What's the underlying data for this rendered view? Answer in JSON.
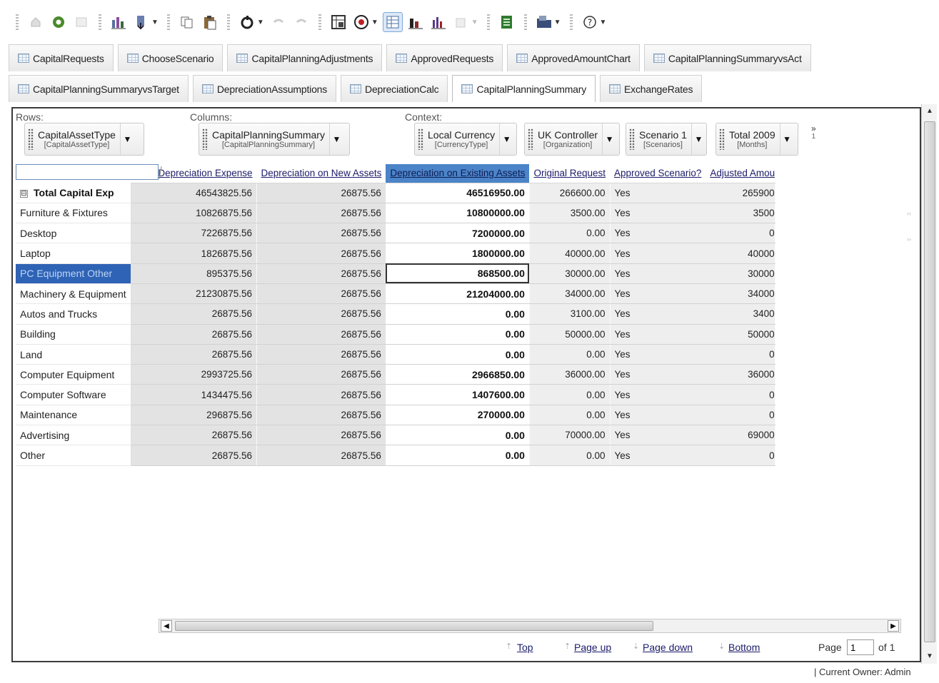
{
  "toolbar": {
    "icons": [
      "home-icon",
      "refresh-icon",
      "blank-icon",
      "chart-edit-icon",
      "export-icon",
      "copy-icon",
      "paste-icon",
      "calculate-icon",
      "undo-icon",
      "redo-icon",
      "grid-view-icon",
      "record-icon",
      "table-view-icon",
      "bar-chart-icon",
      "column-chart-icon",
      "pie-chart-icon",
      "spreadsheet-icon",
      "folder-icon",
      "help-icon"
    ],
    "active_icon": "table-view-icon"
  },
  "tabs_row1": [
    {
      "label": "CapitalRequests"
    },
    {
      "label": "ChooseScenario"
    },
    {
      "label": "CapitalPlanningAdjustments"
    },
    {
      "label": "ApprovedRequests"
    },
    {
      "label": "ApprovedAmountChart"
    },
    {
      "label": "CapitalPlanningSummaryvsAct"
    }
  ],
  "tabs_row2": [
    {
      "label": "CapitalPlanningSummaryvsTarget"
    },
    {
      "label": "DepreciationAssumptions"
    },
    {
      "label": "DepreciationCalc"
    },
    {
      "label": "CapitalPlanningSummary",
      "active": true
    },
    {
      "label": "ExchangeRates"
    }
  ],
  "axes": {
    "rows_label": "Rows:",
    "columns_label": "Columns:",
    "context_label": "Context:",
    "rows_dim": {
      "name": "CapitalAssetType",
      "sub": "[CapitalAssetType]"
    },
    "columns_dim": {
      "name": "CapitalPlanningSummary",
      "sub": "[CapitalPlanningSummary]"
    },
    "context_dims": [
      {
        "name": "Local Currency",
        "sub": "[CurrencyType]"
      },
      {
        "name": "UK Controller",
        "sub": "[Organization]"
      },
      {
        "name": "Scenario 1",
        "sub": "[Scenarios]"
      },
      {
        "name": "Total 2009",
        "sub": "[Months]"
      }
    ],
    "more_label": "»",
    "more_count": "1"
  },
  "grid": {
    "columns": [
      "Total Depreciation Expense",
      "Depreciation on New Assets",
      "Depreciation on Existing Assets",
      "Original Request",
      "Approved Scenario?",
      "Adjusted Amou"
    ],
    "selected_column": 2,
    "rows": [
      {
        "label": "Total Capital Exp",
        "total": true,
        "expander": "⊟",
        "values": [
          "46543825.56",
          "26875.56",
          "46516950.00",
          "266600.00",
          "Yes",
          "265900"
        ]
      },
      {
        "label": "Furniture & Fixtures",
        "values": [
          "10826875.56",
          "26875.56",
          "10800000.00",
          "3500.00",
          "Yes",
          "3500"
        ]
      },
      {
        "label": "Desktop",
        "values": [
          "7226875.56",
          "26875.56",
          "7200000.00",
          "0.00",
          "Yes",
          "0"
        ]
      },
      {
        "label": "Laptop",
        "values": [
          "1826875.56",
          "26875.56",
          "1800000.00",
          "40000.00",
          "Yes",
          "40000"
        ]
      },
      {
        "label": "PC Equipment Other",
        "selected": true,
        "values": [
          "895375.56",
          "26875.56",
          "868500.00",
          "30000.00",
          "Yes",
          "30000"
        ]
      },
      {
        "label": "Machinery & Equipment",
        "values": [
          "21230875.56",
          "26875.56",
          "21204000.00",
          "34000.00",
          "Yes",
          "34000"
        ]
      },
      {
        "label": "Autos and Trucks",
        "values": [
          "26875.56",
          "26875.56",
          "0.00",
          "3100.00",
          "Yes",
          "3400"
        ]
      },
      {
        "label": "Building",
        "values": [
          "26875.56",
          "26875.56",
          "0.00",
          "50000.00",
          "Yes",
          "50000"
        ]
      },
      {
        "label": "Land",
        "values": [
          "26875.56",
          "26875.56",
          "0.00",
          "0.00",
          "Yes",
          "0"
        ]
      },
      {
        "label": "Computer Equipment",
        "values": [
          "2993725.56",
          "26875.56",
          "2966850.00",
          "36000.00",
          "Yes",
          "36000"
        ]
      },
      {
        "label": "Computer Software",
        "values": [
          "1434475.56",
          "26875.56",
          "1407600.00",
          "0.00",
          "Yes",
          "0"
        ]
      },
      {
        "label": "Maintenance",
        "values": [
          "296875.56",
          "26875.56",
          "270000.00",
          "0.00",
          "Yes",
          "0"
        ]
      },
      {
        "label": "Advertising",
        "values": [
          "26875.56",
          "26875.56",
          "0.00",
          "70000.00",
          "Yes",
          "69000"
        ]
      },
      {
        "label": "Other",
        "values": [
          "26875.56",
          "26875.56",
          "0.00",
          "0.00",
          "Yes",
          "0"
        ]
      }
    ]
  },
  "pager": {
    "top": "Top",
    "page_up": "Page up",
    "page_down": "Page down",
    "bottom": "Bottom",
    "page_label": "Page",
    "page_value": "1",
    "of_label": "of 1"
  },
  "status": {
    "owner": "| Current Owner: Admin"
  },
  "colors": {
    "selection": "#2f63b5",
    "column_highlight": "#4b84c8",
    "cell_bg": "#e3e3e3"
  }
}
